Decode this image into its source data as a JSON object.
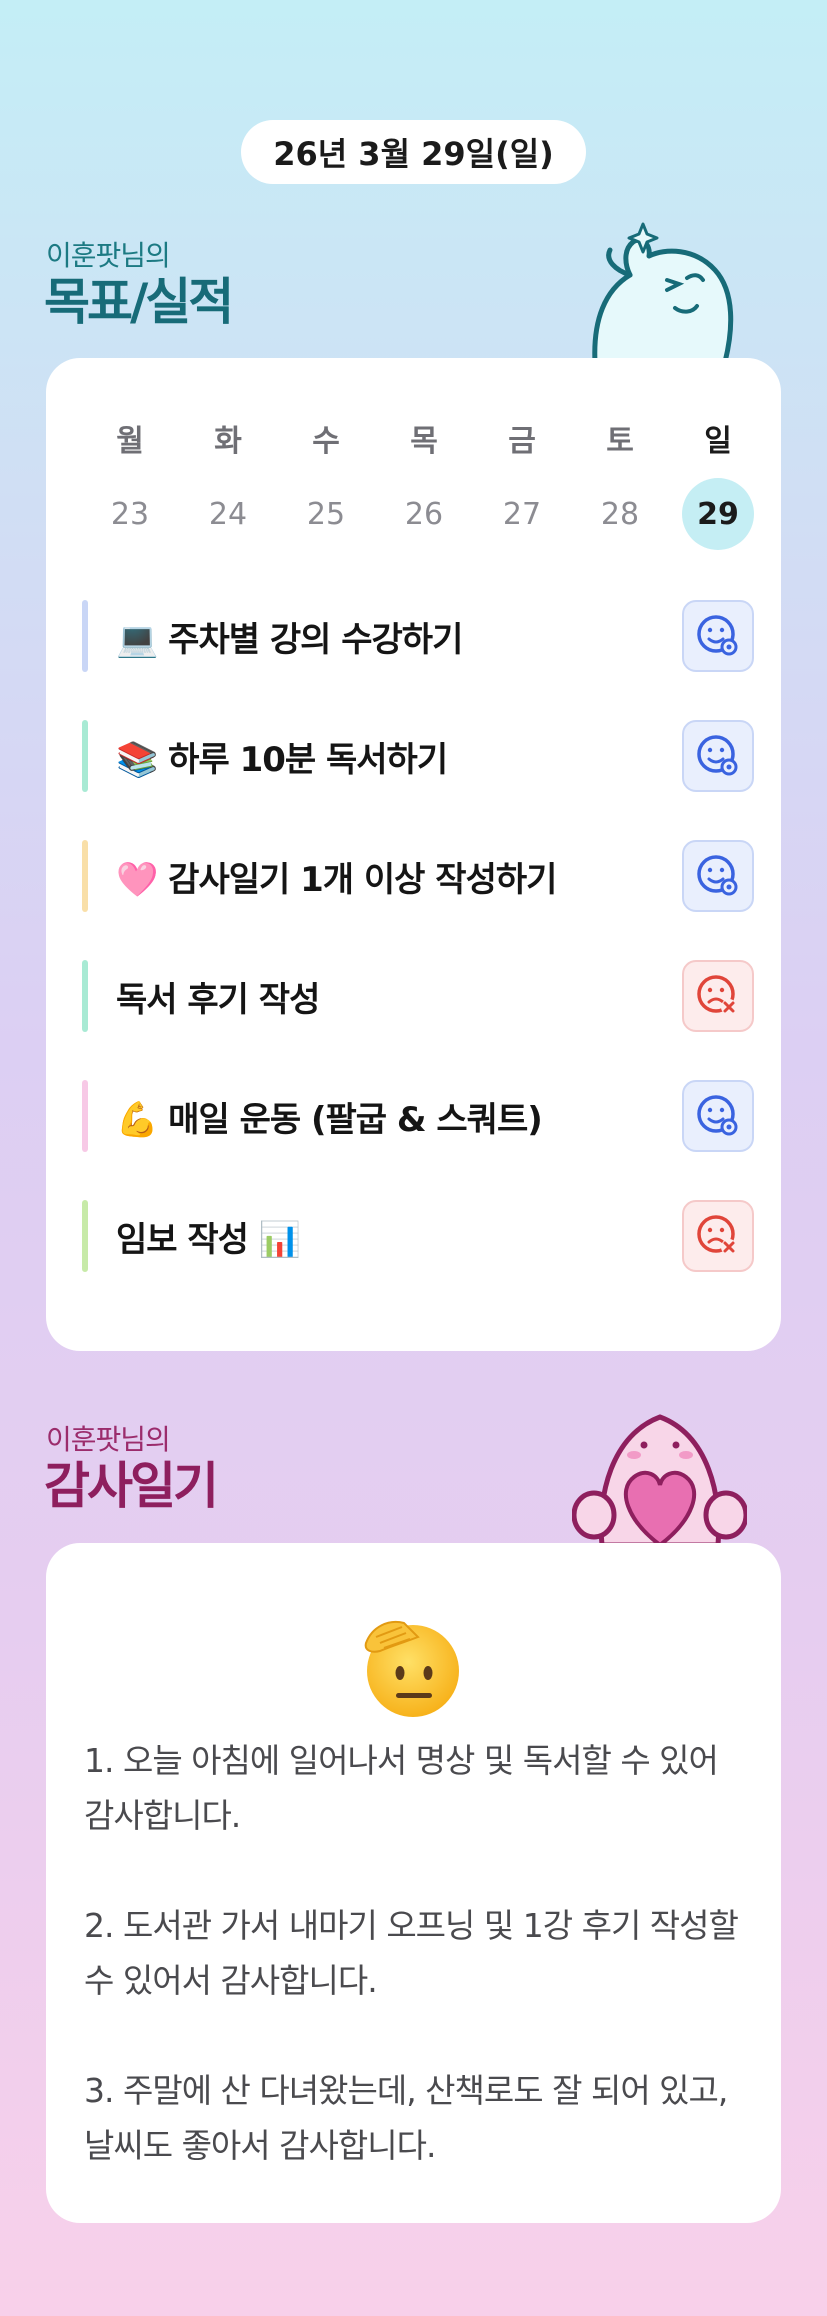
{
  "header": {
    "date": "26년 3월 29일(일)"
  },
  "goals_section": {
    "subtitle": "이훈팟님의",
    "title": "목표/실적"
  },
  "calendar": {
    "weekdays": [
      "월",
      "화",
      "수",
      "목",
      "금",
      "토",
      "일"
    ],
    "dates": [
      "23",
      "24",
      "25",
      "26",
      "27",
      "28",
      "29"
    ],
    "today_index": 6
  },
  "goals": [
    {
      "icon": "laptop-emoji",
      "label": "💻 주차별 강의 수강하기",
      "bar_color": "#c9d6f6",
      "status": "done"
    },
    {
      "icon": "books-emoji",
      "label": "📚 하루 10분 독서하기",
      "bar_color": "#a8ead4",
      "status": "done"
    },
    {
      "icon": "pink-heart-emoji",
      "label": "🩷 감사일기 1개 이상 작성하기",
      "bar_color": "#f9dfa8",
      "status": "done"
    },
    {
      "icon": "",
      "label": "독서 후기 작성",
      "bar_color": "#a8ead4",
      "status": "missed"
    },
    {
      "icon": "flexed-biceps-emoji",
      "label": "💪 매일 운동 (팔굽 & 스쿼트)",
      "bar_color": "#f7c9e6",
      "status": "done"
    },
    {
      "icon": "bar-chart-emoji",
      "label": "임보 작성 📊",
      "bar_color": "#c7eaa8",
      "status": "missed"
    }
  ],
  "gratitude_section": {
    "subtitle": "이훈팟님의",
    "title": "감사일기",
    "emoji": "saluting-face-emoji",
    "items": [
      "1. 오늘 아침에 일어나서 명상 및 독서할 수 있어 감사합니다.",
      "2. 도서관 가서 내마기 오프닝 및 1강 후기 작성할 수 있어서 감사합니다.",
      "3. 주말에 산 다녀왔는데, 산책로도 잘 되어 있고, 날씨도 좋아서 감사합니다."
    ]
  },
  "colors": {
    "goal_title": "#176b78",
    "gratitude_title": "#8e1f5e",
    "today_highlight": "#c5eef4",
    "done_icon": "#3a63e0",
    "missed_icon": "#e0453a"
  }
}
